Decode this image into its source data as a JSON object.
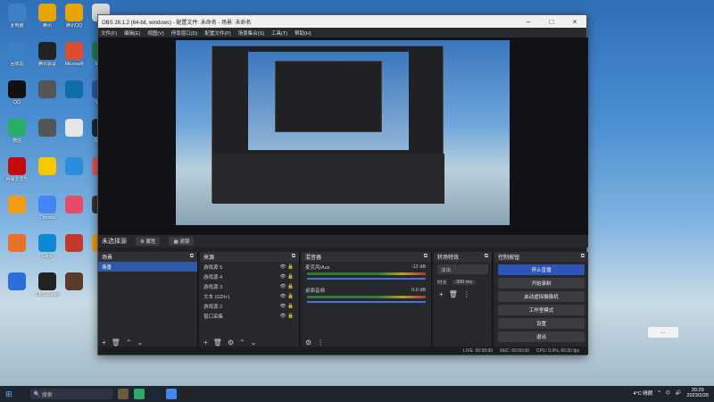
{
  "desktop": {
    "icons": [
      {
        "label": "此电脑",
        "color": "#3b82c4"
      },
      {
        "label": "腾讯",
        "color": "#e6a500"
      },
      {
        "label": "腾讯QQ",
        "color": "#e6a500"
      },
      {
        "label": "",
        "color": "#d9d9d9"
      },
      {
        "label": "回收站",
        "color": "#3b82c4"
      },
      {
        "label": "腾讯会议",
        "color": "#222"
      },
      {
        "label": "Microsoft",
        "color": "#e04c2d"
      },
      {
        "label": "Excel",
        "color": "#1e7b45"
      },
      {
        "label": "QQ",
        "color": "#111"
      },
      {
        "label": "",
        "color": "#555"
      },
      {
        "label": "",
        "color": "#0e6eaa"
      },
      {
        "label": "Word",
        "color": "#2b579a"
      },
      {
        "label": "微信",
        "color": "#2aae67"
      },
      {
        "label": "",
        "color": "#555"
      },
      {
        "label": "",
        "color": "#e6e6e6"
      },
      {
        "label": "Steam",
        "color": "#1b2838"
      },
      {
        "label": "网易云音乐",
        "color": "#c20c0c"
      },
      {
        "label": "",
        "color": "#f6c800"
      },
      {
        "label": "",
        "color": "#2a8de0"
      },
      {
        "label": "",
        "color": "#e55656"
      },
      {
        "label": "",
        "color": "#f39c12"
      },
      {
        "label": "Chrome",
        "color": "#4285f4"
      },
      {
        "label": "",
        "color": "#e84a6a"
      },
      {
        "label": "",
        "color": "#333"
      },
      {
        "label": "",
        "color": "#e8702a"
      },
      {
        "label": "Edge",
        "color": "#0c8ad6"
      },
      {
        "label": "",
        "color": "#c0392b"
      },
      {
        "label": "",
        "color": "#f39c12"
      },
      {
        "label": "",
        "color": "#2a6fdb"
      },
      {
        "label": "OBS Studio",
        "color": "#222"
      },
      {
        "label": "",
        "color": "#5a3a2a"
      }
    ]
  },
  "window": {
    "title": "OBS 28.1.2 (64-bit, windows) - 配置文件: 未命名 - 场景: 未命名",
    "menu": [
      "文件(F)",
      "编辑(E)",
      "视图(V)",
      "停靠窗口(D)",
      "配置文件(P)",
      "场景集合(S)",
      "工具(T)",
      "帮助(H)"
    ]
  },
  "source_bar": {
    "label": "未选择源",
    "props": "属性",
    "filters": "滤镜"
  },
  "docks": {
    "scenes": {
      "title": "场景",
      "items": [
        "场景"
      ]
    },
    "sources": {
      "title": "来源",
      "items": [
        "游戏源 5",
        "游戏源 4",
        "游戏源 3",
        "文本 (GDI+)",
        "游戏源 2",
        "窗口采集"
      ]
    },
    "mixer": {
      "title": "混音器",
      "channels": [
        {
          "name": "麦克风/Aux",
          "db": "-12 dB"
        },
        {
          "name": "桌面音频",
          "db": "0.0 dB"
        }
      ]
    },
    "transitions": {
      "title": "转场特效",
      "type": "淡出",
      "duration_label": "时长",
      "duration": "300 ms"
    },
    "controls": {
      "title": "控制按钮",
      "buttons": [
        "停止直播",
        "开始录制",
        "启动虚拟摄像机",
        "工作室模式",
        "设置",
        "退出"
      ]
    }
  },
  "status": {
    "live": "LIVE: 00:00:00",
    "rec": "REC: 00:00:00",
    "cpu": "CPU: 0.9%, 60.00 fps"
  },
  "taskbar": {
    "search": "搜索",
    "weather": "4°C 晴朗",
    "time": "20:29",
    "date": "2023/2/26"
  },
  "notification": {
    "text": "..."
  }
}
